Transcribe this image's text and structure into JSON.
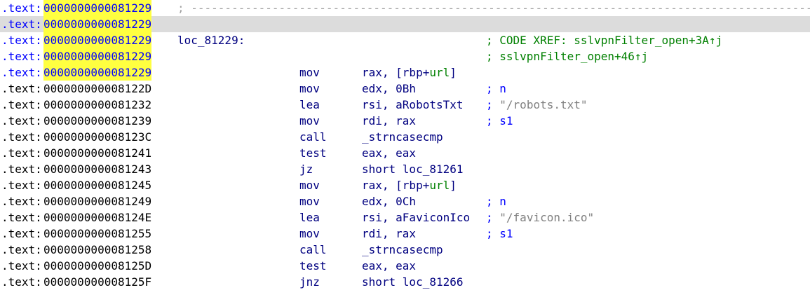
{
  "segment": ".text:",
  "lines": [
    {
      "addr": "0000000000081229",
      "blue": true,
      "sep": "; -----------------------------------------------------------------------------------------------"
    },
    {
      "addr": "0000000000081229",
      "blue": true,
      "current": true
    },
    {
      "addr": "0000000000081229",
      "blue": true,
      "label": "loc_81229:",
      "comment": "; CODE XREF: sslvpnFilter_open+3A↑j",
      "xref": true
    },
    {
      "addr": "0000000000081229",
      "blue": true,
      "comment": "; sslvpnFilter_open+46↑j",
      "xref": true
    },
    {
      "addr": "0000000000081229",
      "blue": true,
      "mnem": "mov",
      "op": "rax, [rbp+",
      "opkw": "url",
      "optail": "]"
    },
    {
      "addr": "000000000008122D",
      "mnem": "mov",
      "op": "edx, 0Bh",
      "comment": "; n"
    },
    {
      "addr": "0000000000081232",
      "mnem": "lea",
      "op": "rsi, aRobotsTxt",
      "comment": ";",
      "str": "\"/robots.txt\""
    },
    {
      "addr": "0000000000081239",
      "mnem": "mov",
      "op": "rdi, rax",
      "comment": "; s1"
    },
    {
      "addr": "000000000008123C",
      "mnem": "call",
      "op": "_strncasecmp"
    },
    {
      "addr": "0000000000081241",
      "mnem": "test",
      "op": "eax, eax"
    },
    {
      "addr": "0000000000081243",
      "mnem": "jz",
      "op": "short loc_81261"
    },
    {
      "addr": "0000000000081245",
      "mnem": "mov",
      "op": "rax, [rbp+",
      "opkw": "url",
      "optail": "]"
    },
    {
      "addr": "0000000000081249",
      "mnem": "mov",
      "op": "edx, 0Ch",
      "comment": "; n"
    },
    {
      "addr": "000000000008124E",
      "mnem": "lea",
      "op": "rsi, aFaviconIco",
      "comment": ";",
      "str": "\"/favicon.ico\""
    },
    {
      "addr": "0000000000081255",
      "mnem": "mov",
      "op": "rdi, rax",
      "comment": "; s1"
    },
    {
      "addr": "0000000000081258",
      "mnem": "call",
      "op": "_strncasecmp"
    },
    {
      "addr": "000000000008125D",
      "mnem": "test",
      "op": "eax, eax"
    },
    {
      "addr": "000000000008125F",
      "mnem": "jnz",
      "op": "short loc_81266"
    }
  ]
}
